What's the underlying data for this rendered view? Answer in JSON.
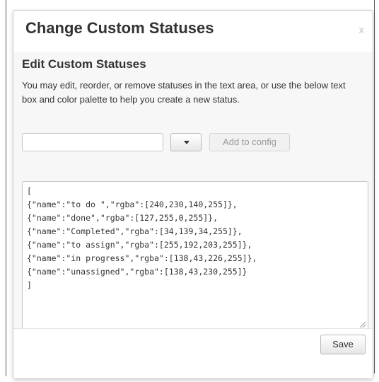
{
  "dialog": {
    "title": "Change Custom Statuses",
    "close_label": "x"
  },
  "section": {
    "heading": "Edit Custom Statuses",
    "description": "You may edit, reorder, or remove statuses in the text area, or use the below text box and color palette to help you create a new status."
  },
  "new_status": {
    "value": "",
    "placeholder": "",
    "color_icon": "chevron-down-icon",
    "add_label": "Add to config"
  },
  "config": {
    "lines": [
      "[",
      "{\"name\":\"to do \",\"rgba\":[240,230,140,255]},",
      "{\"name\":\"done\",\"rgba\":[127,255,0,255]},",
      "{\"name\":\"Completed\",\"rgba\":[34,139,34,255]},",
      "{\"name\":\"to assign\",\"rgba\":[255,192,203,255]},",
      "{\"name\":\"in progress\",\"rgba\":[138,43,226,255]},",
      "{\"name\":\"unassigned\",\"rgba\":[138,43,230,255]}",
      "]"
    ]
  },
  "footer": {
    "save_label": "Save"
  }
}
